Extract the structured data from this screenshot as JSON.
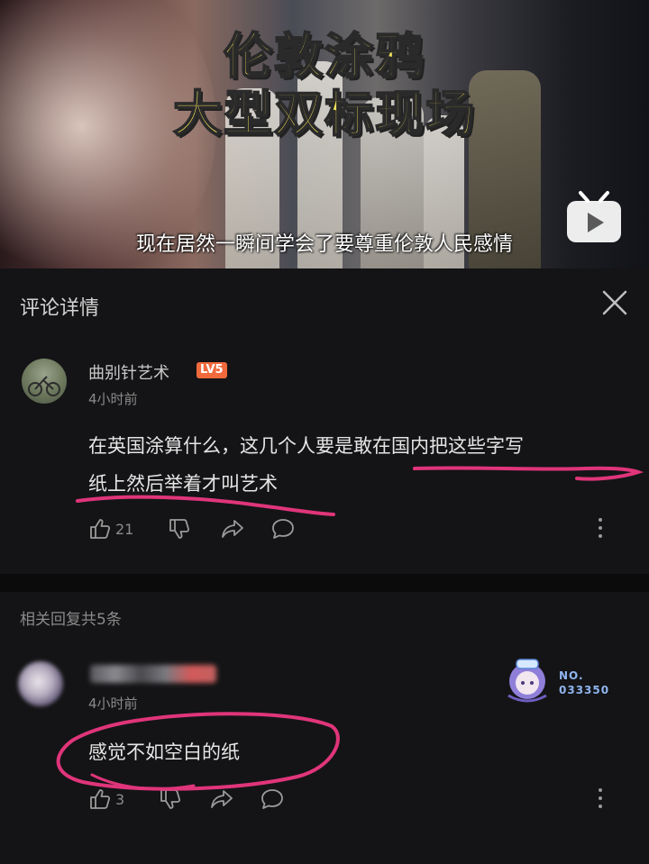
{
  "video": {
    "title_line1": "伦敦涂鸦",
    "title_line2": "大型双标现场",
    "subtitle": "现在居然一瞬间学会了要尊重伦敦人民感情",
    "logo_icon": "bilibili-tv-icon"
  },
  "panel": {
    "title": "评论详情",
    "close_icon": "close-icon"
  },
  "main_comment": {
    "username": "曲别针艺术",
    "level": "LV5",
    "time": "4小时前",
    "text_line1": "在英国涂算什么，这几个人要是敢在国内把这些字写",
    "text_line2": "纸上然后举着才叫艺术",
    "likes": "21"
  },
  "replies": {
    "header": "相关回复共5条",
    "items": [
      {
        "time": "4小时前",
        "text": "感觉不如空白的纸",
        "likes": "3",
        "badge_label": "NO.",
        "badge_number": "033350"
      }
    ]
  },
  "colors": {
    "background": "#141416",
    "annotation": "#e0357a",
    "level_badge": "#f06a3c",
    "title_yellow": "#f5e35a"
  }
}
